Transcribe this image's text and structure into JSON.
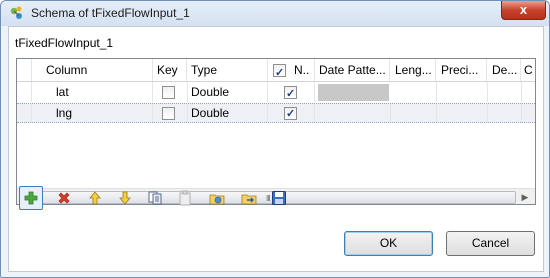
{
  "window": {
    "title": "Schema of tFixedFlowInput_1",
    "close_glyph": "x"
  },
  "component_name": "tFixedFlowInput_1",
  "table": {
    "headers": [
      "Column",
      "Key",
      "Type",
      "N..",
      "Date Patte...",
      "Leng...",
      "Preci...",
      "De...",
      "C"
    ],
    "header_nullable_checked": true,
    "rows": [
      {
        "column": "lat",
        "key": false,
        "type": "Double",
        "nullable": true
      },
      {
        "column": "lng",
        "key": false,
        "type": "Double",
        "nullable": true
      }
    ],
    "scroll_grip": "III"
  },
  "toolbar": {
    "icons": [
      "add-icon",
      "remove-icon",
      "move-up-icon",
      "move-down-icon",
      "copy-icon",
      "paste-icon",
      "import-icon",
      "export-icon",
      "save-icon"
    ]
  },
  "buttons": {
    "ok": "OK",
    "cancel": "Cancel"
  }
}
